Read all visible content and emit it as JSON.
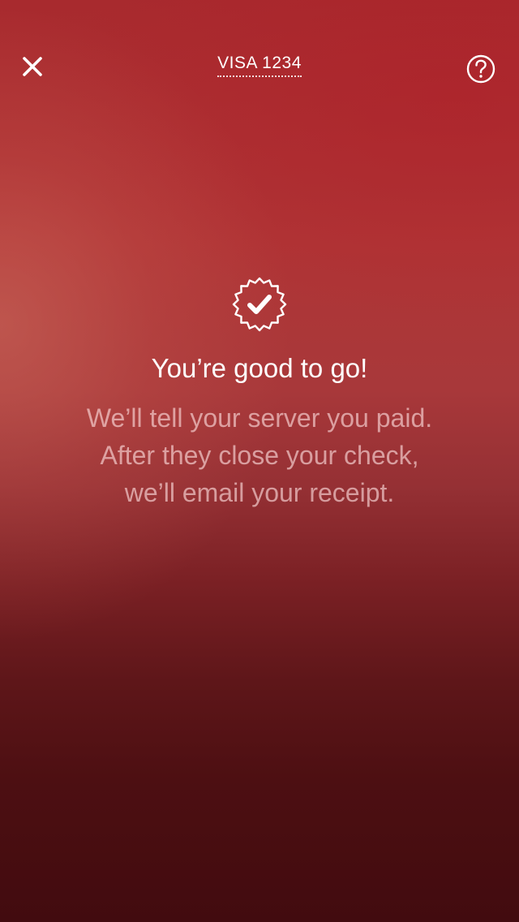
{
  "header": {
    "close_icon": "close-icon",
    "card_label": "VISA 1234",
    "help_icon": "question-mark-circle-icon"
  },
  "confirmation": {
    "icon": "checkmark-badge-icon",
    "title": "You’re good to go!",
    "message_lines": [
      "We’ll tell your server you paid.",
      "After they close your check,",
      "we’ll email your receipt."
    ]
  },
  "colors": {
    "background_top": "#a82a2e",
    "background_bottom": "#420b0f",
    "text_primary": "#ffffff"
  }
}
